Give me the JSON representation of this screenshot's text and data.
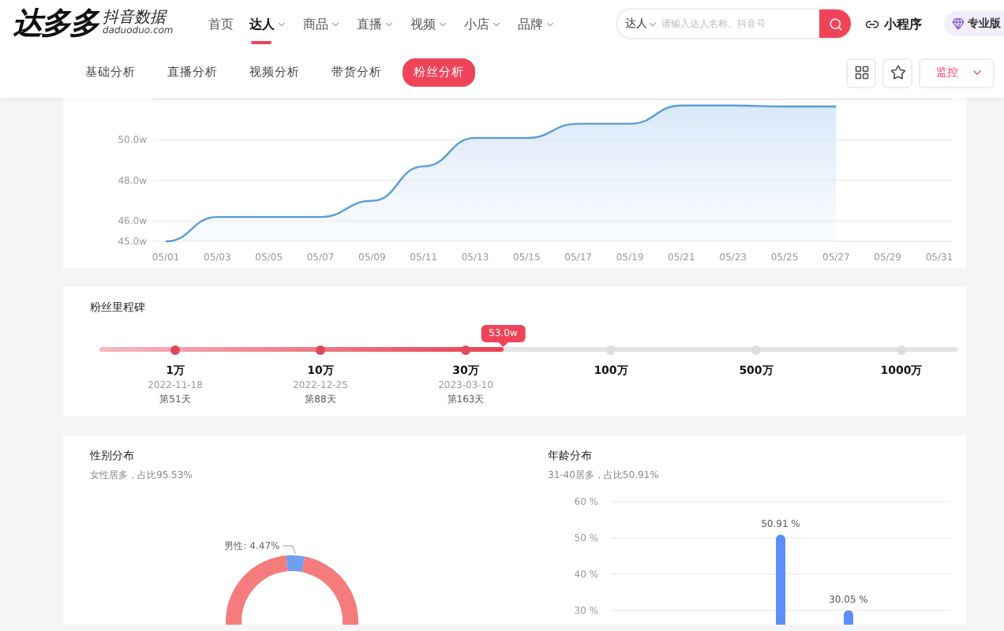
{
  "header": {
    "logo": {
      "name": "达多多",
      "tagline": "抖音数据",
      "domain": "daduoduo.com"
    },
    "nav": [
      {
        "label": "首页",
        "has_menu": false,
        "selected": false
      },
      {
        "label": "达人",
        "has_menu": true,
        "selected": true
      },
      {
        "label": "商品",
        "has_menu": true,
        "selected": false
      },
      {
        "label": "直播",
        "has_menu": true,
        "selected": false
      },
      {
        "label": "视频",
        "has_menu": true,
        "selected": false
      },
      {
        "label": "小店",
        "has_menu": true,
        "selected": false
      },
      {
        "label": "品牌",
        "has_menu": true,
        "selected": false
      }
    ],
    "search": {
      "scope": "达人",
      "placeholder": "请输入达人名称、抖音号"
    },
    "mini_program": "小程序",
    "pro_badge": "专业版"
  },
  "tabs": [
    {
      "label": "基础分析",
      "selected": false
    },
    {
      "label": "直播分析",
      "selected": false
    },
    {
      "label": "视频分析",
      "selected": false
    },
    {
      "label": "带货分析",
      "selected": false
    },
    {
      "label": "粉丝分析",
      "selected": true
    }
  ],
  "monitor": "监控",
  "fans_trend": {
    "chart_data": {
      "type": "area",
      "grid": true,
      "ylim": [
        45,
        52
      ],
      "yticks": [
        {
          "value": 45,
          "label": "45.0w"
        },
        {
          "value": 46,
          "label": "46.0w"
        },
        {
          "value": 48,
          "label": "48.0w"
        },
        {
          "value": 50,
          "label": "50.0w"
        }
      ],
      "categories": [
        "05/01",
        "05/03",
        "05/05",
        "05/07",
        "05/09",
        "05/11",
        "05/13",
        "05/15",
        "05/17",
        "05/19",
        "05/21",
        "05/23",
        "05/25",
        "05/27",
        "05/29",
        "05/31"
      ],
      "values": [
        45.0,
        46.2,
        46.2,
        46.2,
        47.0,
        48.7,
        50.1,
        50.1,
        50.8,
        50.8,
        51.7,
        51.7,
        51.65,
        51.65,
        null,
        null
      ]
    }
  },
  "milestones": {
    "title": "粉丝里程碑",
    "current": {
      "text": "53.0w",
      "level": 0.47
    },
    "points": [
      {
        "label": "1万",
        "reached": true,
        "date": "2022-11-18",
        "day": "第51天"
      },
      {
        "label": "10万",
        "reached": true,
        "date": "2022-12-25",
        "day": "第88天"
      },
      {
        "label": "30万",
        "reached": true,
        "date": "2023-03-10",
        "day": "第163天"
      },
      {
        "label": "100万",
        "reached": false
      },
      {
        "label": "500万",
        "reached": false
      },
      {
        "label": "1000万",
        "reached": false
      }
    ]
  },
  "gender": {
    "title": "性别分布",
    "summary": "女性居多，占比95.53%",
    "chart_data": {
      "type": "donut",
      "values": [
        95.53,
        4.47
      ],
      "value_labels": [
        null,
        "男性: 4.47%"
      ]
    }
  },
  "age": {
    "title": "年龄分布",
    "summary": "31-40居多，占比50.91%",
    "chart_data": {
      "type": "bar",
      "grid": true,
      "ylim": [
        0,
        60
      ],
      "yticks": [
        {
          "value": 30,
          "label": "30 %"
        },
        {
          "value": 40,
          "label": "40 %"
        },
        {
          "value": 50,
          "label": "50 %"
        },
        {
          "value": 60,
          "label": "60 %"
        }
      ],
      "values": [
        null,
        null,
        50.91,
        30.05,
        null
      ],
      "value_labels": [
        null,
        null,
        "50.91 %",
        "30.05 %",
        null
      ]
    }
  }
}
